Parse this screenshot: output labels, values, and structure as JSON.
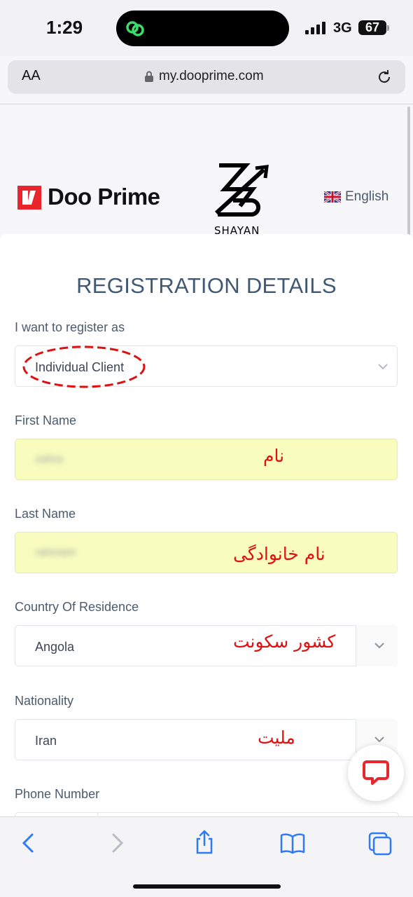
{
  "status_bar": {
    "time": "1:29",
    "network": "3G",
    "battery": "67"
  },
  "browser": {
    "text_size_label": "AA",
    "url": "my.dooprime.com"
  },
  "header": {
    "brand": "Doo Prime",
    "watermark_text": "SHAYAN",
    "language": "English"
  },
  "page": {
    "title": "REGISTRATION DETAILS"
  },
  "form": {
    "register_as": {
      "label": "I want to register as",
      "value": "Individual Client"
    },
    "first_name": {
      "label": "First Name",
      "value": "zahra",
      "annotation": "نام"
    },
    "last_name": {
      "label": "Last Name",
      "value": "rahmani",
      "annotation": "نام خانوادگی"
    },
    "country": {
      "label": "Country Of Residence",
      "value": "Angola",
      "annotation": "کشور سکونت"
    },
    "nationality": {
      "label": "Nationality",
      "value": "Iran",
      "annotation": "ملیت"
    },
    "phone": {
      "label": "Phone Number"
    }
  },
  "colors": {
    "accent": "#3f5873",
    "brand_red": "#e8262b",
    "annotation_red": "#e01010",
    "ios_blue": "#2f7bf6",
    "autofill_yellow": "#f8fdbf"
  },
  "icons": [
    "green-link-icon",
    "signal-icon",
    "lock-icon",
    "reload-icon",
    "uk-flag-icon",
    "chevron-down-icon",
    "chat-icon",
    "back-icon",
    "forward-icon",
    "share-icon",
    "bookmarks-icon",
    "tabs-icon"
  ]
}
